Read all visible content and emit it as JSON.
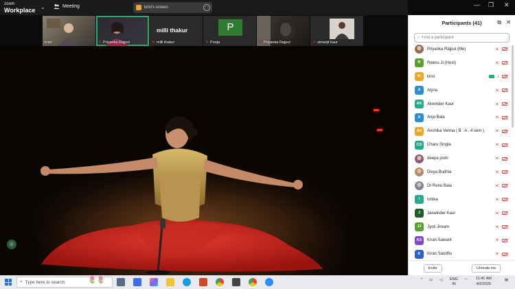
{
  "titlebar": {
    "logo_line1": "zoom",
    "logo_line2": "Workplace",
    "meeting_label": "Meeting",
    "share_label": "krist's screen"
  },
  "video_strip": [
    {
      "name": "krist",
      "muted": false,
      "kind": "video"
    },
    {
      "name": "Priyanka Rajput",
      "muted": true,
      "kind": "video",
      "active": true
    },
    {
      "name": "milli thakur",
      "muted": true,
      "kind": "name",
      "big_name": "milli thakur"
    },
    {
      "name": "Pooja",
      "muted": true,
      "kind": "initial",
      "initial": "P"
    },
    {
      "name": "Priyanka Rajput",
      "muted": true,
      "kind": "video"
    },
    {
      "name": "simarjit kaur",
      "muted": true,
      "kind": "video"
    }
  ],
  "participants": {
    "header": "Participants (41)",
    "search_placeholder": "Find a participant",
    "items": [
      {
        "name": "Priyanka Rajput (Me)",
        "initials": "",
        "color": "#8a6d5a",
        "photo": true,
        "video_on": false,
        "mic_on": false
      },
      {
        "name": "Reenu JI (Host)",
        "initials": "R",
        "color": "#5aa02c",
        "photo": false,
        "video_on": false,
        "mic_on": false
      },
      {
        "name": "krist",
        "initials": "K",
        "color": "#e8a92a",
        "photo": false,
        "video_on": true,
        "mic_on": true
      },
      {
        "name": "Alyna",
        "initials": "A",
        "color": "#2b8fd6",
        "photo": false,
        "video_on": false,
        "mic_on": false
      },
      {
        "name": "Akwinder Kaur",
        "initials": "AK",
        "color": "#27a98b",
        "photo": false,
        "video_on": false,
        "mic_on": false
      },
      {
        "name": "Anju Bala",
        "initials": "A",
        "color": "#2b8fd6",
        "photo": false,
        "video_on": false,
        "mic_on": false
      },
      {
        "name": "Anchika Verma ( B . A . 4 sem )",
        "initials": "AV",
        "color": "#e8a92a",
        "photo": false,
        "video_on": false,
        "mic_on": false
      },
      {
        "name": "Charu Singla",
        "initials": "CS",
        "color": "#27a98b",
        "photo": false,
        "video_on": false,
        "mic_on": false
      },
      {
        "name": "deepa joshi",
        "initials": "",
        "color": "#8a5a7a",
        "photo": true,
        "video_on": false,
        "mic_on": false
      },
      {
        "name": "Divya Budhia",
        "initials": "",
        "color": "#b08a6a",
        "photo": true,
        "video_on": false,
        "mic_on": false
      },
      {
        "name": "Dr Renu Bala",
        "initials": "",
        "color": "#7a8a9a",
        "photo": true,
        "video_on": false,
        "mic_on": false
      },
      {
        "name": "Ishika",
        "initials": "I",
        "color": "#27a98b",
        "photo": false,
        "video_on": false,
        "mic_on": false
      },
      {
        "name": "Jaswinder Kaur",
        "initials": "J",
        "color": "#1f5c2e",
        "photo": false,
        "video_on": false,
        "mic_on": false
      },
      {
        "name": "Jyoti Jiream",
        "initials": "JJ",
        "color": "#5aa02c",
        "photo": false,
        "video_on": false,
        "mic_on": false
      },
      {
        "name": "Kiran Sawant",
        "initials": "KS",
        "color": "#7b4bc8",
        "photo": false,
        "video_on": false,
        "mic_on": false
      },
      {
        "name": "Kiran Sandhu",
        "initials": "K",
        "color": "#2b62c8",
        "photo": false,
        "video_on": false,
        "mic_on": false
      }
    ],
    "invite_label": "Invite",
    "unmute_label": "Unmute me"
  },
  "taskbar": {
    "search_placeholder": "Type here to search",
    "lang_line1": "ENG",
    "lang_line2": "IN",
    "time": "11:41 AM",
    "date": "4/2/2025"
  }
}
